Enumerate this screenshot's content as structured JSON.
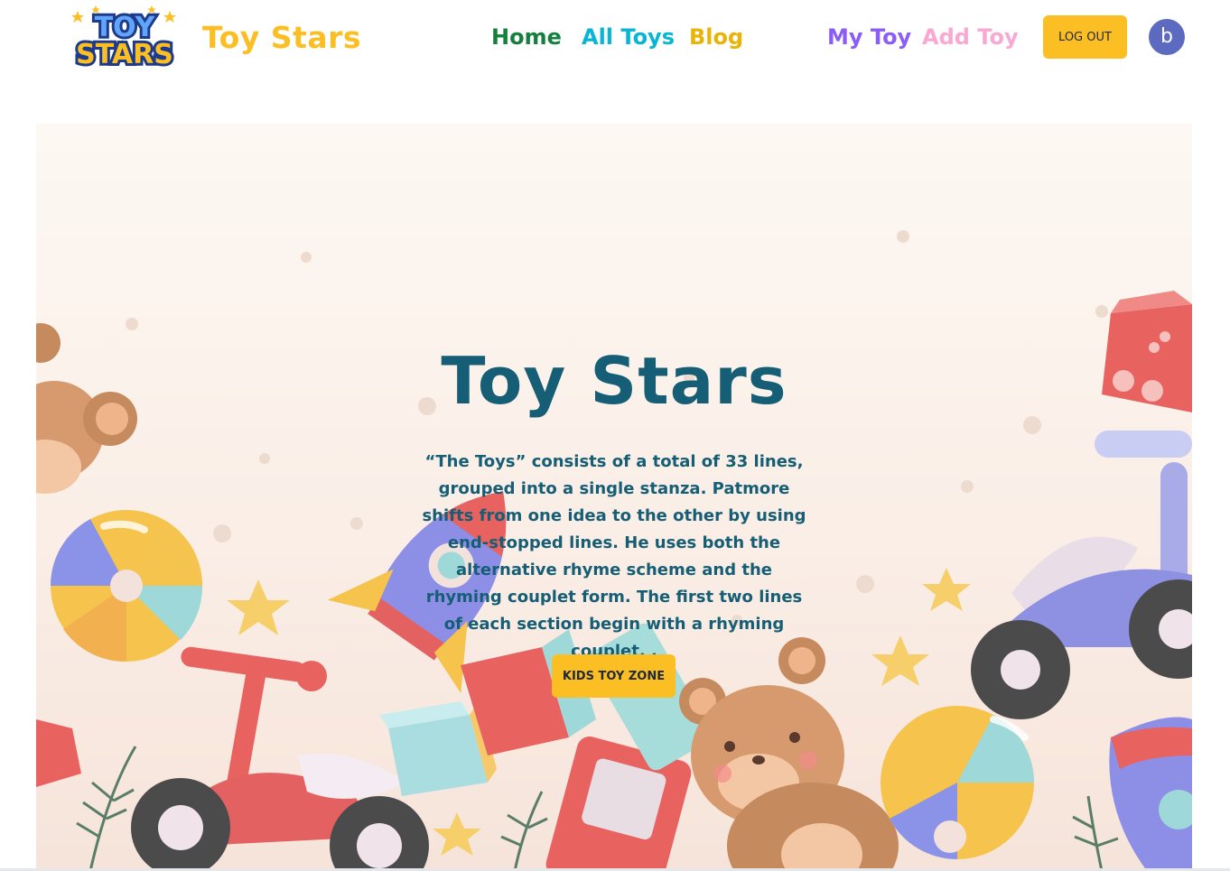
{
  "nav": {
    "logo_text_top": "TOY",
    "logo_text_bottom": "STARS",
    "brand": "Toy Stars",
    "links": {
      "home": "Home",
      "all_toys": "All Toys",
      "blog": "Blog",
      "my_toy": "My Toy",
      "add_toy": "Add Toy"
    },
    "logout_label": "LOG OUT",
    "avatar_letter": "b"
  },
  "hero": {
    "title": "Toy Stars",
    "description": "“The Toys” consists of a total of 33 lines, grouped into a single stanza. Patmore shifts from one idea to the other by using end-stopped lines. He uses both the alternative rhyme scheme and the rhyming couplet form. The first two lines of each section begin with a rhyming couplet. .",
    "button_label": "KIDS TOY ZONE"
  },
  "colors": {
    "accent": "#fbbf24",
    "home": "#15803d",
    "all_toys": "#06b6d4",
    "blog": "#eab308",
    "my_toy": "#8b5cf6",
    "add_toy": "#f9a8d4",
    "hero_text": "#155e75",
    "avatar": "#5c6bc0"
  },
  "icons": [
    "logo-icon",
    "teddy-bear-icon",
    "beach-ball-icon",
    "rocket-icon",
    "bicycle-icon",
    "toy-block-icon",
    "handheld-game-icon",
    "star-icon"
  ]
}
